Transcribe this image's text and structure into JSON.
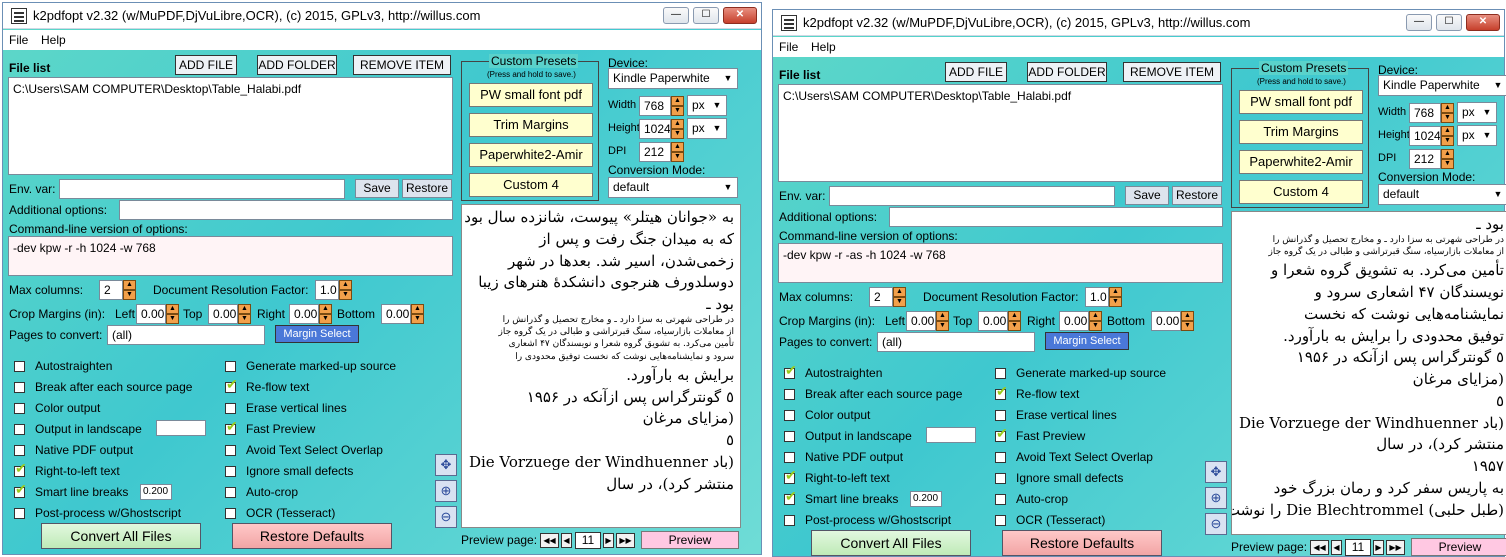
{
  "windows": [
    {
      "title": "k2pdfopt v2.32 (w/MuPDF,DjVuLibre,OCR), (c) 2015, GPLv3, http://willus.com",
      "menu": [
        "File",
        "Help"
      ],
      "file_list_label": "File list",
      "add_file": "ADD FILE",
      "add_folder": "ADD FOLDER",
      "remove_item": "REMOVE ITEM",
      "file_path": "C:\\Users\\SAM COMPUTER\\Desktop\\Table_Halabi.pdf",
      "env_var_label": "Env. var:",
      "env_var_value": "",
      "save": "Save",
      "restore": "Restore",
      "additional_options_label": "Additional options:",
      "additional_options_value": "",
      "cmdline_label": "Command-line version of options:",
      "cmdline": "-dev kpw -r -h 1024 -w 768",
      "max_columns_label": "Max columns:",
      "max_columns": "2",
      "doc_res_label": "Document Resolution Factor:",
      "doc_res": "1.0",
      "crop_label": "Crop Margins (in):",
      "left_label": "Left",
      "left": "0.00",
      "top_label": "Top",
      "top": "0.00",
      "right_label": "Right",
      "right": "0.00",
      "bottom_label": "Bottom",
      "bottom": "0.00",
      "pages_label": "Pages to convert:",
      "pages": "(all)",
      "margin_select": "Margin Select",
      "presets_title": "Custom Presets",
      "presets_sub": "(Press and hold to save.)",
      "presets": [
        "PW small font pdf",
        "Trim Margins",
        "Paperwhite2-Amir",
        "Custom 4"
      ],
      "device_label": "Device:",
      "device": "Kindle Paperwhite",
      "width_label": "Width",
      "width": "768",
      "width_unit": "px",
      "height_label": "Height",
      "height": "1024",
      "height_unit": "px",
      "dpi_label": "DPI",
      "dpi": "212",
      "conv_mode_label": "Conversion Mode:",
      "conv_mode": "default",
      "left_checks": [
        {
          "label": "Autostraighten",
          "checked": false
        },
        {
          "label": "Break after each source page",
          "checked": false
        },
        {
          "label": "Color output",
          "checked": false
        },
        {
          "label": "Output in landscape",
          "checked": false
        },
        {
          "label": "Native PDF output",
          "checked": false
        },
        {
          "label": "Right-to-left text",
          "checked": true
        },
        {
          "label": "Smart line breaks",
          "checked": true
        },
        {
          "label": "Post-process w/Ghostscript",
          "checked": false
        }
      ],
      "right_checks": [
        {
          "label": "Generate marked-up source",
          "checked": false
        },
        {
          "label": "Re-flow text",
          "checked": true
        },
        {
          "label": "Erase vertical lines",
          "checked": false
        },
        {
          "label": "Fast Preview",
          "checked": true
        },
        {
          "label": "Avoid Text Select Overlap",
          "checked": false
        },
        {
          "label": "Ignore small defects",
          "checked": false
        },
        {
          "label": "Auto-crop",
          "checked": false
        },
        {
          "label": "OCR (Tesseract)",
          "checked": false
        }
      ],
      "smart_breaks_value": "0.200",
      "convert_all": "Convert All Files",
      "restore_defaults": "Restore Defaults",
      "preview_page_label": "Preview page:",
      "preview_page": "11",
      "preview_btn": "Preview",
      "preview_lines": [
        "به «جوانان هیتلر» پیوست، شانزده سال بود",
        "که به میدان جنگ رفت و پس از",
        "زخمی‌شدن، اسیر شد. بعدها در شهر",
        "دوسلدورف هنرجوی دانشکدهٔ هنرهای زیبا",
        "بود ـ",
        "در طراحی شهرتی به سزا دارد ـ و مخارج تحصیل و گذرانش را",
        "از معاملات بازارسیاه، سنگ قبرتراشی و طبالی در یک گروه جاز",
        "تأمین می‌کرد. به تشویق گروه شعرا و نویسندگان ۴۷ اشعاری",
        "سرود و نمایشنامه‌هایی نوشت که نخست توفیق محدودی را",
        "برایش به بارآورد.",
        "٥ گونترگراس پس ازآنکه در ۱۹۵۶",
        "(مزایای مرغان",
        "٥",
        "(باد Die Vorzuege der Windhuenner",
        "منتشر کرد)، در سال"
      ]
    },
    {
      "title": "k2pdfopt v2.32 (w/MuPDF,DjVuLibre,OCR), (c) 2015, GPLv3, http://willus.com",
      "menu": [
        "File",
        "Help"
      ],
      "file_list_label": "File list",
      "add_file": "ADD FILE",
      "add_folder": "ADD FOLDER",
      "remove_item": "REMOVE ITEM",
      "file_path": "C:\\Users\\SAM COMPUTER\\Desktop\\Table_Halabi.pdf",
      "env_var_label": "Env. var:",
      "env_var_value": "",
      "save": "Save",
      "restore": "Restore",
      "additional_options_label": "Additional options:",
      "additional_options_value": "",
      "cmdline_label": "Command-line version of options:",
      "cmdline": "-dev kpw -r -as -h 1024 -w 768",
      "max_columns_label": "Max columns:",
      "max_columns": "2",
      "doc_res_label": "Document Resolution Factor:",
      "doc_res": "1.0",
      "crop_label": "Crop Margins (in):",
      "left_label": "Left",
      "left": "0.00",
      "top_label": "Top",
      "top": "0.00",
      "right_label": "Right",
      "right": "0.00",
      "bottom_label": "Bottom",
      "bottom": "0.00",
      "pages_label": "Pages to convert:",
      "pages": "(all)",
      "margin_select": "Margin Select",
      "presets_title": "Custom Presets",
      "presets_sub": "(Press and hold to save.)",
      "presets": [
        "PW small font pdf",
        "Trim Margins",
        "Paperwhite2-Amir",
        "Custom 4"
      ],
      "device_label": "Device:",
      "device": "Kindle Paperwhite",
      "width_label": "Width",
      "width": "768",
      "width_unit": "px",
      "height_label": "Height",
      "height": "1024",
      "height_unit": "px",
      "dpi_label": "DPI",
      "dpi": "212",
      "conv_mode_label": "Conversion Mode:",
      "conv_mode": "default",
      "left_checks": [
        {
          "label": "Autostraighten",
          "checked": true
        },
        {
          "label": "Break after each source page",
          "checked": false
        },
        {
          "label": "Color output",
          "checked": false
        },
        {
          "label": "Output in landscape",
          "checked": false
        },
        {
          "label": "Native PDF output",
          "checked": false
        },
        {
          "label": "Right-to-left text",
          "checked": true
        },
        {
          "label": "Smart line breaks",
          "checked": true
        },
        {
          "label": "Post-process w/Ghostscript",
          "checked": false
        }
      ],
      "right_checks": [
        {
          "label": "Generate marked-up source",
          "checked": false
        },
        {
          "label": "Re-flow text",
          "checked": true
        },
        {
          "label": "Erase vertical lines",
          "checked": false
        },
        {
          "label": "Fast Preview",
          "checked": true
        },
        {
          "label": "Avoid Text Select Overlap",
          "checked": false
        },
        {
          "label": "Ignore small defects",
          "checked": false
        },
        {
          "label": "Auto-crop",
          "checked": false
        },
        {
          "label": "OCR (Tesseract)",
          "checked": false
        }
      ],
      "smart_breaks_value": "0.200",
      "convert_all": "Convert All Files",
      "restore_defaults": "Restore Defaults",
      "preview_page_label": "Preview page:",
      "preview_page": "11",
      "preview_btn": "Preview",
      "preview_lines": [
        "بود ـ",
        "در طراحی شهرتی به سزا دارد ـ و مخارج تحصیل و گذرانش را",
        "از معاملات بازارسیاه، سنگ قبرتراشی و طبالی در یک گروه جاز",
        "تأمین می‌کرد. به تشویق گروه شعرا و",
        "نویسندگان ۴۷ اشعاری   سرود و",
        "نمایشنامه‌هایی نوشت که نخست",
        "توفیق محدودی را برایش به بارآورد.",
        "٥ گونترگراس پس ازآنکه در ۱۹۵۶",
        "(مزایای مرغان",
        "٥",
        "(باد Die Vorzuege der Windhuenner",
        "منتشر کرد)، در سال",
        "۱۹۵۷",
        "به پاریس سفر کرد و رمان بزرگ خود",
        "(طبل حلبی) Die Blechtrommel را نوشت،"
      ]
    }
  ]
}
